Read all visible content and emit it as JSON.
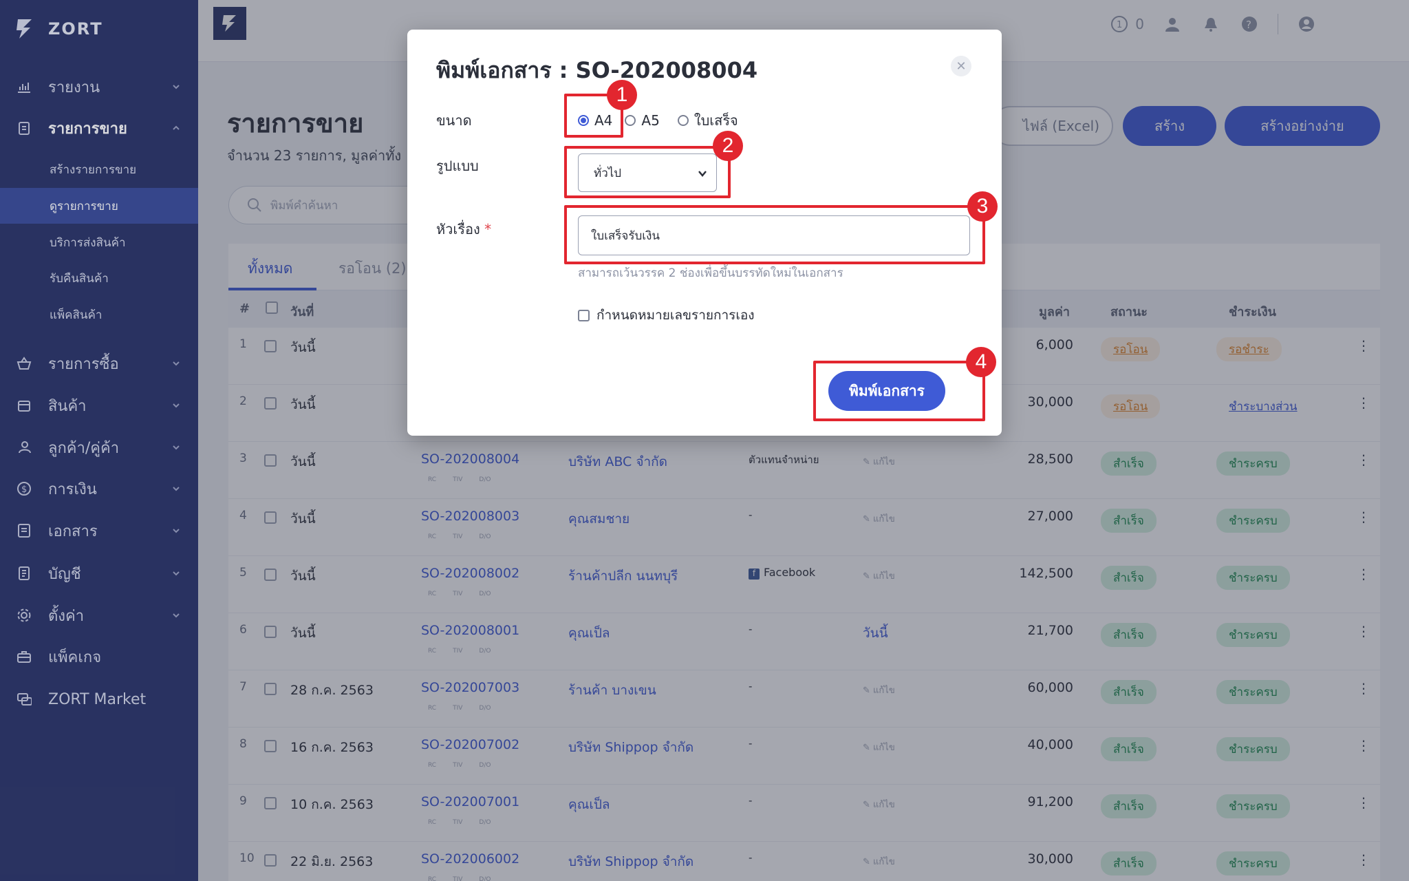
{
  "sidebar": {
    "brand": "ZORT",
    "items": [
      {
        "label": "รายงาน",
        "icon": "chart-icon"
      },
      {
        "label": "รายการขาย",
        "icon": "clipboard-icon"
      },
      {
        "label": "รายการซื้อ",
        "icon": "basket-icon"
      },
      {
        "label": "สินค้า",
        "icon": "box-icon"
      },
      {
        "label": "ลูกค้า/คู่ค้า",
        "icon": "users-icon"
      },
      {
        "label": "การเงิน",
        "icon": "dollar-icon"
      },
      {
        "label": "เอกสาร",
        "icon": "document-icon"
      },
      {
        "label": "บัญชี",
        "icon": "ledger-icon"
      },
      {
        "label": "ตั้งค่า",
        "icon": "gear-icon"
      },
      {
        "label": "แพ็คเกจ",
        "icon": "briefcase-icon"
      },
      {
        "label": "ZORT Market",
        "icon": "chat-icon"
      }
    ],
    "sub_items": [
      {
        "label": "สร้างรายการขาย"
      },
      {
        "label": "ดูรายการขาย"
      },
      {
        "label": "บริการส่งสินค้า"
      },
      {
        "label": "รับคืนสินค้า"
      },
      {
        "label": "แพ็คสินค้า"
      }
    ]
  },
  "topbar": {
    "notif_count": "0"
  },
  "main": {
    "title": "รายการขาย",
    "subtitle": "จำนวน 23 รายการ, มูลค่าทั้ง",
    "search_placeholder": "พิมพ์คำค้นหา",
    "btn_excel": "ไฟล์ (Excel)",
    "btn_create": "สร้าง",
    "btn_easy": "สร้างอย่างง่าย",
    "tabs": [
      "ทั้งหมด",
      "รอโอน (2)"
    ],
    "headers": {
      "num": "#",
      "date": "วันที่",
      "value": "มูลค่า",
      "status": "สถานะ",
      "payment": "ชำระเงิน"
    },
    "mini_tags": [
      "RC",
      "TIV",
      "D/O"
    ],
    "edit_label": "แก้ไข",
    "rows": [
      {
        "n": "1",
        "date": "วันนี้",
        "so": "",
        "customer": "",
        "channel": "",
        "note": "",
        "value": "6,000",
        "status": "รอโอน",
        "pay": "รอชำระ"
      },
      {
        "n": "2",
        "date": "วันนี้",
        "so": "",
        "customer": "",
        "channel": "",
        "note": "",
        "value": "30,000",
        "status": "รอโอน",
        "pay": "ชำระบางส่วน"
      },
      {
        "n": "3",
        "date": "วันนี้",
        "so": "SO-202008004",
        "customer": "บริษัท ABC จำกัด",
        "channel": "ตัวแทนจำหน่าย",
        "note": "แก้ไข",
        "value": "28,500",
        "status": "สำเร็จ",
        "pay": "ชำระครบ"
      },
      {
        "n": "4",
        "date": "วันนี้",
        "so": "SO-202008003",
        "customer": "คุณสมชาย",
        "channel": "-",
        "note": "แก้ไข",
        "value": "27,000",
        "status": "สำเร็จ",
        "pay": "ชำระครบ"
      },
      {
        "n": "5",
        "date": "วันนี้",
        "so": "SO-202008002",
        "customer": "ร้านค้าปลีก นนทบุรี",
        "channel": "Facebook",
        "note": "แก้ไข",
        "value": "142,500",
        "status": "สำเร็จ",
        "pay": "ชำระครบ"
      },
      {
        "n": "6",
        "date": "วันนี้",
        "so": "SO-202008001",
        "customer": "คุณเป็ล",
        "channel": "-",
        "note": "วันนี้",
        "value": "21,700",
        "status": "สำเร็จ",
        "pay": "ชำระครบ"
      },
      {
        "n": "7",
        "date": "28 ก.ค. 2563",
        "so": "SO-202007003",
        "customer": "ร้านค้า บางเขน",
        "channel": "-",
        "note": "แก้ไข",
        "value": "60,000",
        "status": "สำเร็จ",
        "pay": "ชำระครบ"
      },
      {
        "n": "8",
        "date": "16 ก.ค. 2563",
        "so": "SO-202007002",
        "customer": "บริษัท Shippop จำกัด",
        "channel": "-",
        "note": "แก้ไข",
        "value": "40,000",
        "status": "สำเร็จ",
        "pay": "ชำระครบ"
      },
      {
        "n": "9",
        "date": "10 ก.ค. 2563",
        "so": "SO-202007001",
        "customer": "คุณเป็ล",
        "channel": "-",
        "note": "แก้ไข",
        "value": "91,200",
        "status": "สำเร็จ",
        "pay": "ชำระครบ"
      },
      {
        "n": "10",
        "date": "22 มิ.ย. 2563",
        "so": "SO-202006002",
        "customer": "บริษัท Shippop จำกัด",
        "channel": "-",
        "note": "แก้ไข",
        "value": "30,000",
        "status": "สำเร็จ",
        "pay": "ชำระครบ"
      }
    ]
  },
  "modal": {
    "title": "พิมพ์เอกสาร : SO-202008004",
    "size_label": "ขนาด",
    "sizes": [
      "A4",
      "A5",
      "ใบเสร็จ"
    ],
    "selected_size": "A4",
    "format_label": "รูปแบบ",
    "format_value": "ทั่วไป",
    "title_label": "หัวเรื่อง",
    "required_mark": "*",
    "title_value": "ใบเสร็จรับเงิน",
    "hint": "สามารถเว้นวรรค 2 ช่องเพื่อขึ้นบรรทัดใหม่ในเอกสาร",
    "custom_number_label": "กำหนดหมายเลขรายการเอง",
    "print_button": "พิมพ์เอกสาร"
  },
  "callouts": [
    "1",
    "2",
    "3",
    "4"
  ],
  "colors": {
    "sidebar": "#2a3468",
    "accent": "#3f5bd6",
    "callout": "#e2262f"
  }
}
